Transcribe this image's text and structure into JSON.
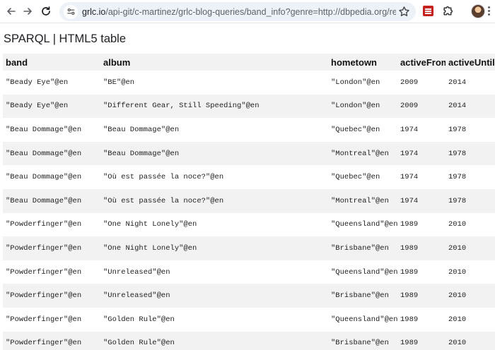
{
  "browser": {
    "url_host": "grlc.io",
    "url_rest": "/api-git/c-martinez/grlc-blog-queries/band_info?genre=http://dbpedia.org/resource/Ro..."
  },
  "page": {
    "title": "SPARQL | HTML5 table"
  },
  "table": {
    "headers": [
      "band",
      "album",
      "hometown",
      "activeFrom",
      "activeUntil"
    ],
    "rows": [
      [
        "\"Beady Eye\"@en",
        "\"BE\"@en",
        "\"London\"@en",
        "2009",
        "2014"
      ],
      [
        "\"Beady Eye\"@en",
        "\"Different Gear, Still Speeding\"@en",
        "\"London\"@en",
        "2009",
        "2014"
      ],
      [
        "\"Beau Dommage\"@en",
        "\"Beau Dommage\"@en",
        "\"Quebec\"@en",
        "1974",
        "1978"
      ],
      [
        "\"Beau Dommage\"@en",
        "\"Beau Dommage\"@en",
        "\"Montreal\"@en",
        "1974",
        "1978"
      ],
      [
        "\"Beau Dommage\"@en",
        "\"Où est passée la noce?\"@en",
        "\"Quebec\"@en",
        "1974",
        "1978"
      ],
      [
        "\"Beau Dommage\"@en",
        "\"Où est passée la noce?\"@en",
        "\"Montreal\"@en",
        "1974",
        "1978"
      ],
      [
        "\"Powderfinger\"@en",
        "\"One Night Lonely\"@en",
        "\"Queensland\"@en",
        "1989",
        "2010"
      ],
      [
        "\"Powderfinger\"@en",
        "\"One Night Lonely\"@en",
        "\"Brisbane\"@en",
        "1989",
        "2010"
      ],
      [
        "\"Powderfinger\"@en",
        "\"Unreleased\"@en",
        "\"Queensland\"@en",
        "1989",
        "2010"
      ],
      [
        "\"Powderfinger\"@en",
        "\"Unreleased\"@en",
        "\"Brisbane\"@en",
        "1989",
        "2010"
      ],
      [
        "\"Powderfinger\"@en",
        "\"Golden Rule\"@en",
        "\"Queensland\"@en",
        "1989",
        "2010"
      ],
      [
        "\"Powderfinger\"@en",
        "\"Golden Rule\"@en",
        "\"Brisbane\"@en",
        "1989",
        "2010"
      ]
    ]
  },
  "icons": {
    "back": "back-arrow-icon",
    "forward": "forward-arrow-icon",
    "reload": "reload-icon",
    "site_info": "site-info-icon",
    "bookmark": "star-icon",
    "extension": "extension-icon",
    "extensions_menu": "puzzle-icon",
    "profile": "profile-avatar",
    "menu": "more-vert-icon"
  },
  "colors": {
    "row_stripe": "#f2f2f2",
    "omnibox": "#edf1f8",
    "extension_red": "#c5221f"
  }
}
